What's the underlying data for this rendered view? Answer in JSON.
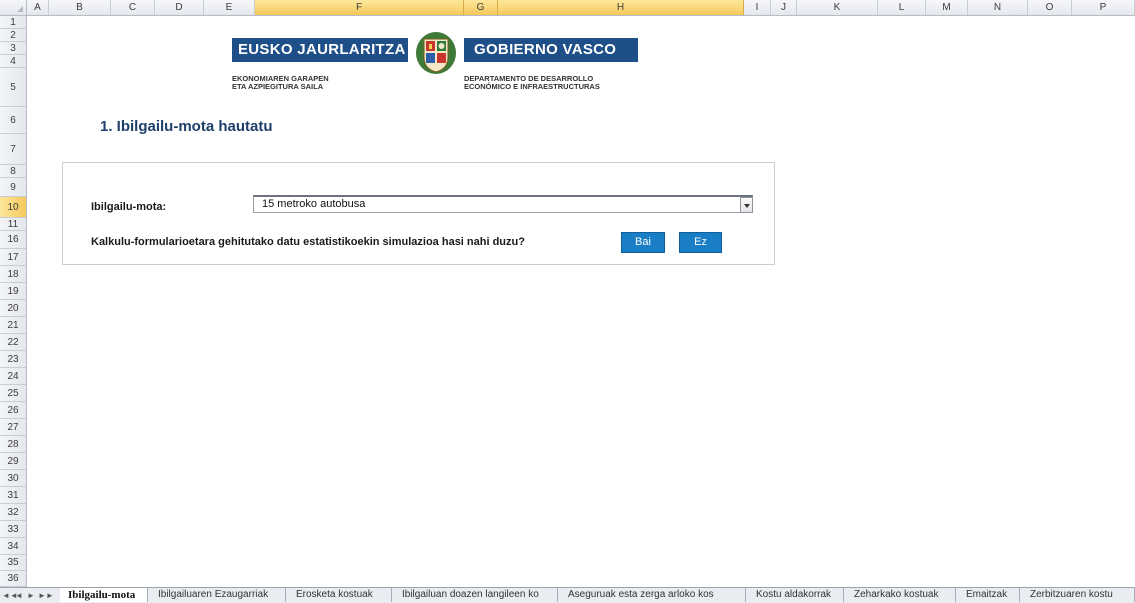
{
  "columns": [
    "A",
    "B",
    "C",
    "D",
    "E",
    "F",
    "G",
    "H",
    "I",
    "J",
    "K",
    "L",
    "M",
    "N",
    "O",
    "P"
  ],
  "selected_columns": [
    "F",
    "G",
    "H"
  ],
  "rows": [
    "1",
    "2",
    "3",
    "4",
    "5",
    "6",
    "7",
    "8",
    "9",
    "10",
    "11",
    "16",
    "17",
    "18",
    "19",
    "20",
    "21",
    "22",
    "23",
    "24",
    "25",
    "26",
    "27",
    "28",
    "29",
    "30",
    "31",
    "32",
    "33",
    "34",
    "35",
    "36"
  ],
  "selected_row": "10",
  "logo": {
    "left_title": "EUSKO JAURLARITZA",
    "right_title": "GOBIERNO VASCO",
    "left_sub_1": "EKONOMIAREN GARAPEN",
    "left_sub_2": "ETA AZPIEGITURA SAILA",
    "right_sub_1": "DEPARTAMENTO DE DESARROLLO",
    "right_sub_2": "ECONÓMICO E INFRAESTRUCTURAS"
  },
  "form": {
    "title": "1. Ibilgailu-mota hautatu",
    "vehicle_label": "Ibilgailu-mota:",
    "vehicle_value": "15 metroko autobusa",
    "question": "Kalkulu-formularioetara gehitutako datu estatistikoekin simulazioa hasi nahi duzu?",
    "yes_button": "Bai",
    "no_button": "Ez"
  },
  "sheet_nav": {
    "first": "◄◄",
    "prev": "◄",
    "next": "►",
    "last": "►►"
  },
  "tabs": [
    "Ibilgailu-mota",
    "Ibilgailuaren Ezaugarriak",
    "Erosketa kostuak",
    "Ibilgailuan doazen langileen ko",
    "Aseguruak esta zerga arloko kos",
    "Kostu aldakorrak",
    "Zeharkako kostuak",
    "Emaitzak",
    "Zerbitzuaren kostu"
  ],
  "active_tab": 0,
  "colors": {
    "brand_blue": "#1f4f88",
    "title_blue": "#1f3f6b",
    "button_blue": "#1a7ec6",
    "selection_orange": "#f5c85a"
  }
}
